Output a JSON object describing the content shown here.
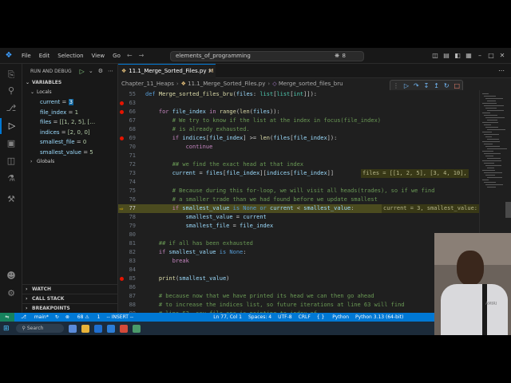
{
  "titlebar": {
    "menu": [
      "File",
      "Edit",
      "Selection",
      "View",
      "Go"
    ],
    "search_text": "elements_of_programming",
    "search_count": "8"
  },
  "sidebar": {
    "title": "RUN AND DEBUG",
    "variables_header": "VARIABLES",
    "locals_header": "Locals",
    "locals": [
      {
        "name": "current",
        "value": "3",
        "highlight": true
      },
      {
        "name": "file_index",
        "value": "1",
        "highlight": false
      },
      {
        "name": "files",
        "value": "[[1, 2, 5], […",
        "highlight": false
      },
      {
        "name": "indices",
        "value": "[2, 0, 0]",
        "highlight": false
      },
      {
        "name": "smallest_file",
        "value": "0",
        "highlight": false
      },
      {
        "name": "smallest_value",
        "value": "5",
        "highlight": false
      }
    ],
    "globals_header": "Globals",
    "watch_header": "WATCH",
    "callstack_header": "CALL STACK",
    "breakpoints_header": "BREAKPOINTS"
  },
  "tab": {
    "label": "11.1_Merge_Sorted_Files.py",
    "modified": "M"
  },
  "breadcrumb": [
    "Chapter_11_Heaps",
    "11.1_Merge_Sorted_Files.py",
    "Merge_sorted_files_bru"
  ],
  "code": [
    {
      "n": "55",
      "bp": "none",
      "html": "<span class=\"kwd\">def</span> <span class=\"fn\">Merge_sorted_files_bru</span>(<span class=\"var\">files</span>: <span class=\"typ\">list</span>[<span class=\"typ\">list</span>[<span class=\"typ\">int</span>]]):"
    },
    {
      "n": "63",
      "bp": "dot",
      "html": ""
    },
    {
      "n": "66",
      "bp": "dot",
      "html": "    <span class=\"kw\">for</span> <span class=\"var\">file_index</span> <span class=\"kw\">in</span> <span class=\"fn\">range</span>(<span class=\"fn\">len</span>(<span class=\"var\">files</span>)):"
    },
    {
      "n": "67",
      "bp": "none",
      "html": "        <span class=\"com\"># We try to know if the list at the index in focus(file_index)</span>"
    },
    {
      "n": "68",
      "bp": "none",
      "html": "        <span class=\"com\"># is already exhausted.</span>"
    },
    {
      "n": "69",
      "bp": "dot",
      "html": "        <span class=\"kw\">if</span> <span class=\"var\">indices</span>[<span class=\"var\">file_index</span>] &gt;= <span class=\"fn\">len</span>(<span class=\"var\">files</span>[<span class=\"var\">file_index</span>]):"
    },
    {
      "n": "70",
      "bp": "none",
      "html": "            <span class=\"kw\">continue</span>"
    },
    {
      "n": "71",
      "bp": "none",
      "html": ""
    },
    {
      "n": "72",
      "bp": "none",
      "html": "        <span class=\"com\">## we find the exact head at that index</span>"
    },
    {
      "n": "73",
      "bp": "none",
      "html": "        <span class=\"var\">current</span> = <span class=\"var\">files</span>[<span class=\"var\">file_index</span>][<span class=\"var\">indices</span>[<span class=\"var\">file_index</span>]]"
    },
    {
      "n": "74",
      "bp": "none",
      "html": ""
    },
    {
      "n": "75",
      "bp": "none",
      "html": "        <span class=\"com\"># Because during this for-loop, we will visit all heads(trades), so if we find</span>"
    },
    {
      "n": "76",
      "bp": "none",
      "html": "        <span class=\"com\"># a smaller trade than we had found before we update smallest</span>"
    },
    {
      "n": "77",
      "bp": "arrow",
      "html": "        <span class=\"kw\">if</span> <span class=\"var\">smallest_value</span> <span class=\"kwd\">is</span> <span class=\"cons\">None</span> <span class=\"kwd\">or</span> <span class=\"var\">current</span> &lt; <span class=\"var\">smallest_value</span>:"
    },
    {
      "n": "78",
      "bp": "none",
      "html": "            <span class=\"var\">smallest_value</span> = <span class=\"var\">current</span>"
    },
    {
      "n": "79",
      "bp": "none",
      "html": "            <span class=\"var\">smallest_file</span> = <span class=\"var\">file_index</span>"
    },
    {
      "n": "80",
      "bp": "none",
      "html": ""
    },
    {
      "n": "81",
      "bp": "none",
      "html": "    <span class=\"com\">## if all has been exhausted</span>"
    },
    {
      "n": "82",
      "bp": "none",
      "html": "    <span class=\"kw\">if</span> <span class=\"var\">smallest_value</span> <span class=\"kwd\">is</span> <span class=\"cons\">None</span>:"
    },
    {
      "n": "83",
      "bp": "none",
      "html": "        <span class=\"kw\">break</span>"
    },
    {
      "n": "84",
      "bp": "none",
      "html": ""
    },
    {
      "n": "85",
      "bp": "dot",
      "html": "    <span class=\"fn\">print</span>(<span class=\"var\">smallest_value</span>)"
    },
    {
      "n": "86",
      "bp": "none",
      "html": ""
    },
    {
      "n": "87",
      "bp": "none",
      "html": "    <span class=\"com\"># because now that we have printed its head we can then go ahead</span>"
    },
    {
      "n": "88",
      "bp": "none",
      "html": "    <span class=\"com\"># to increase the indices list, so future iterations at line 63 will find</span>"
    },
    {
      "n": "89",
      "bp": "none",
      "html": "    <span class=\"com\"># line 63, say file one is pointing to index of</span>"
    }
  ],
  "inline_values": {
    "line73": "files = [[1, 2, 5], [3, 4, 10],",
    "line77": "current = 3, smallest_value:"
  },
  "status": {
    "branch": "main*",
    "sync": "↻",
    "errors": "68",
    "warnings": "1",
    "mode": "-- INSERT --",
    "position": "Ln 77, Col 1",
    "spaces": "Spaces: 4",
    "encoding": "UTF-8",
    "eol": "CRLF",
    "language": "Python",
    "interpreter": "Python 3.13 (64-bit)"
  },
  "taskbar": {
    "search": "Search"
  },
  "webcam": {
    "shirt_text": "AMIRI"
  }
}
